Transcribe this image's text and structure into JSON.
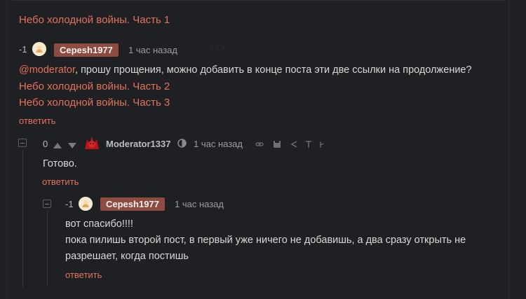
{
  "post_links": {
    "part1": "Небо холодной войны. Часть 1"
  },
  "comment1": {
    "rating": "-1",
    "author": "Cepesh1977",
    "time": "1 час назад",
    "mention": "@moderator",
    "text": ", прошу прощения, можно добавить в конце поста эти две ссылки на продолжение?",
    "link2": "Небо холодной войны. Часть 2",
    "link3": "Небо холодной войны. Часть 3",
    "reply": "ответить"
  },
  "comment2": {
    "rating": "0",
    "author": "Moderator1337",
    "time": "1 час назад",
    "text": "Готово.",
    "reply": "ответить"
  },
  "comment3": {
    "rating": "-1",
    "author": "Cepesh1977",
    "time": "1 час назад",
    "line1": "вот спасибо!!!!",
    "line2": "пока пилишь второй пост, в первый уже ничего не добавишь, а два сразу открыть не",
    "line3": "разрешает, когда постишь",
    "reply": "ответить"
  },
  "icons": [
    "avatar-icon",
    "arrow-up-icon",
    "arrow-down-icon",
    "shield-icon",
    "link-icon",
    "save-icon",
    "share-icon",
    "pin-icon",
    "more-icon",
    "collapse-icon"
  ],
  "colors": {
    "background": "#1f2023",
    "accent": "#e2725b",
    "badge": "#8e4b40"
  }
}
